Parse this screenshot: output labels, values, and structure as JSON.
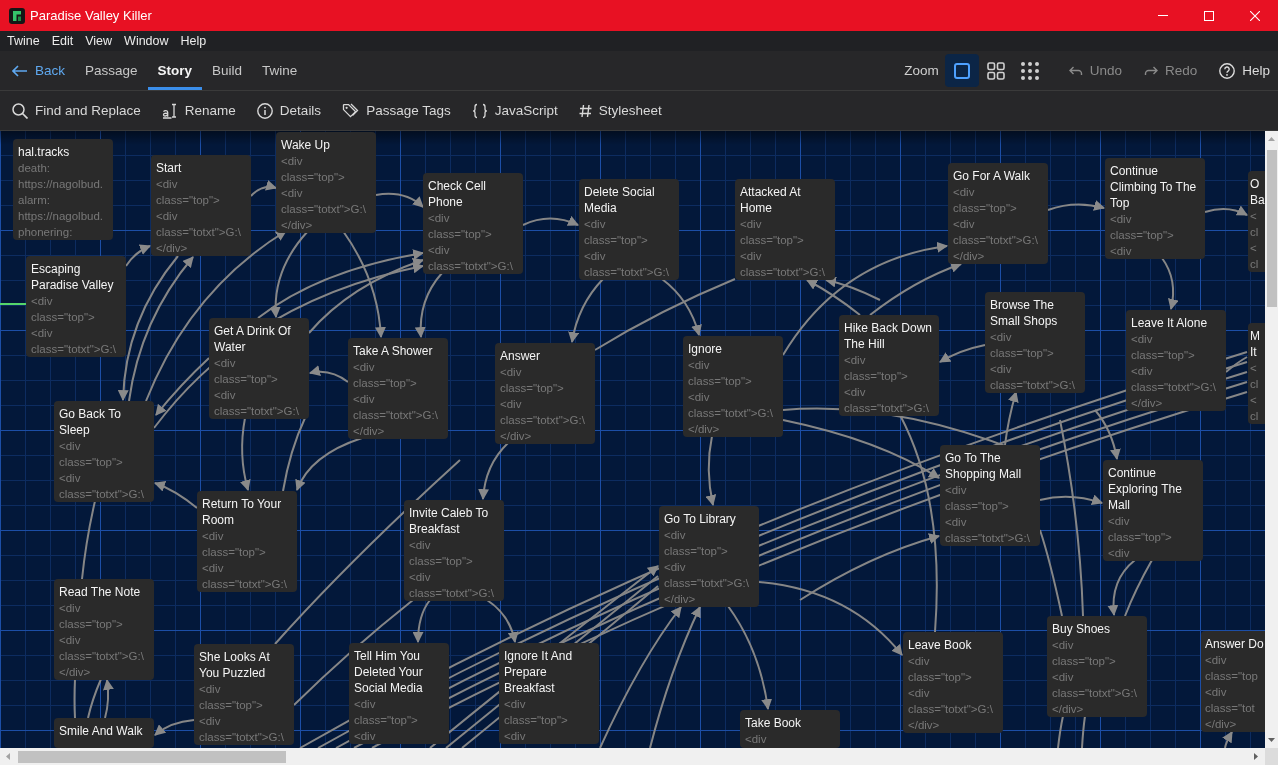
{
  "window": {
    "title": "Paradise Valley Killer"
  },
  "menu_bar": [
    "Twine",
    "Edit",
    "View",
    "Window",
    "Help"
  ],
  "nav": {
    "back": "Back",
    "tabs": [
      {
        "label": "Passage",
        "selected": false
      },
      {
        "label": "Story",
        "selected": true
      },
      {
        "label": "Build",
        "selected": false
      },
      {
        "label": "Twine",
        "selected": false
      }
    ]
  },
  "zoom": {
    "label": "Zoom",
    "levels": [
      {
        "kind": "square",
        "selected": true
      },
      {
        "kind": "grid",
        "selected": false
      },
      {
        "kind": "dots",
        "selected": false
      }
    ]
  },
  "history": [
    {
      "kind": "undo",
      "label": "Undo",
      "disabled": true
    },
    {
      "kind": "redo",
      "label": "Redo",
      "disabled": true
    }
  ],
  "help": {
    "label": "Help"
  },
  "story_tools": [
    {
      "kind": "find",
      "label": "Find and Replace"
    },
    {
      "kind": "rename",
      "label": "Rename"
    },
    {
      "kind": "details",
      "label": "Details"
    },
    {
      "kind": "tags",
      "label": "Passage Tags"
    },
    {
      "kind": "javascript",
      "label": "JavaScript"
    },
    {
      "kind": "stylesheet",
      "label": "Stylesheet"
    }
  ],
  "passages": [
    {
      "title": "hal.tracks",
      "excerpt": [
        "death:",
        "https://nagolbud.",
        "alarm:",
        "https://nagolbud.",
        "phonering:"
      ]
    },
    {
      "title": "Start",
      "excerpt": [
        "<div",
        "class=\"top\">",
        "<div",
        "class=\"totxt\">G:\\",
        "</div>"
      ]
    },
    {
      "title": "Wake Up",
      "excerpt": [
        "<div",
        "class=\"top\">",
        "<div",
        "class=\"totxt\">G:\\",
        "</div>"
      ]
    },
    {
      "title": "Check Cell Phone",
      "excerpt": [
        "<div",
        "class=\"top\">",
        "<div",
        "class=\"totxt\">G:\\"
      ]
    },
    {
      "title": "Delete Social Media",
      "excerpt": [
        "<div",
        "class=\"top\">",
        "<div",
        "class=\"totxt\">G:\\"
      ]
    },
    {
      "title": "Attacked At Home",
      "excerpt": [
        "<div",
        "class=\"top\">",
        "<div",
        "class=\"totxt\">G:\\"
      ]
    },
    {
      "title": "Go For A Walk",
      "excerpt": [
        "<div",
        "class=\"top\">",
        "<div",
        "class=\"totxt\">G:\\",
        "</div>"
      ]
    },
    {
      "title": "Continue Climbing To The Top",
      "excerpt": [
        "<div",
        "class=\"top\">",
        "<div"
      ]
    },
    {
      "title": "O Ba",
      "excerpt": [
        "<",
        "cl",
        "<",
        "cl"
      ]
    },
    {
      "title": "Escaping Paradise Valley",
      "excerpt": [
        "<div",
        "class=\"top\">",
        "<div",
        "class=\"totxt\">G:\\"
      ]
    },
    {
      "title": "Get A Drink Of Water",
      "excerpt": [
        "<div",
        "class=\"top\">",
        "<div",
        "class=\"totxt\">G:\\"
      ]
    },
    {
      "title": "Take A Shower",
      "excerpt": [
        "<div",
        "class=\"top\">",
        "<div",
        "class=\"totxt\">G:\\",
        "</div>"
      ]
    },
    {
      "title": "Answer",
      "excerpt": [
        "<div",
        "class=\"top\">",
        "<div",
        "class=\"totxt\">G:\\",
        "</div>"
      ]
    },
    {
      "title": "Ignore",
      "excerpt": [
        "<div",
        "class=\"top\">",
        "<div",
        "class=\"totxt\">G:\\",
        "</div>"
      ]
    },
    {
      "title": "Hike Back Down The Hill",
      "excerpt": [
        "<div",
        "class=\"top\">",
        "<div",
        "class=\"totxt\">G:\\"
      ]
    },
    {
      "title": "Browse The Small Shops",
      "excerpt": [
        "<div",
        "class=\"top\">",
        "<div",
        "class=\"totxt\">G:\\"
      ]
    },
    {
      "title": "Leave It Alone",
      "excerpt": [
        "<div",
        "class=\"top\">",
        "<div",
        "class=\"totxt\">G:\\",
        "</div>"
      ]
    },
    {
      "title": "M It",
      "excerpt": [
        "<",
        "cl",
        "<",
        "cl"
      ]
    },
    {
      "title": "Go Back To Sleep",
      "excerpt": [
        "<div",
        "class=\"top\">",
        "<div",
        "class=\"totxt\">G:\\"
      ]
    },
    {
      "title": "Return To Your Room",
      "excerpt": [
        "<div",
        "class=\"top\">",
        "<div",
        "class=\"totxt\">G:\\"
      ]
    },
    {
      "title": "Invite Caleb To Breakfast",
      "excerpt": [
        "<div",
        "class=\"top\">",
        "<div",
        "class=\"totxt\">G:\\"
      ]
    },
    {
      "title": "Go To Library",
      "excerpt": [
        "<div",
        "class=\"top\">",
        "<div",
        "class=\"totxt\">G:\\",
        "</div>"
      ]
    },
    {
      "title": "Go To The Shopping Mall",
      "excerpt": [
        "<div",
        "class=\"top\">",
        "<div",
        "class=\"totxt\">G:\\"
      ]
    },
    {
      "title": "Continue Exploring The Mall",
      "excerpt": [
        "<div",
        "class=\"top\">",
        "<div"
      ]
    },
    {
      "title": "Read The Note",
      "excerpt": [
        "<div",
        "class=\"top\">",
        "<div",
        "class=\"totxt\">G:\\",
        "</div>"
      ]
    },
    {
      "title": "She Looks At You Puzzled",
      "excerpt": [
        "<div",
        "class=\"top\">",
        "<div",
        "class=\"totxt\">G:\\"
      ]
    },
    {
      "title": "Tell Him You Deleted Your Social Media",
      "excerpt": [
        "<div",
        "class=\"top\">",
        "<div"
      ]
    },
    {
      "title": "Ignore It And Prepare Breakfast",
      "excerpt": [
        "<div",
        "class=\"top\">",
        "<div"
      ]
    },
    {
      "title": "Leave Book",
      "excerpt": [
        "<div",
        "class=\"top\">",
        "<div",
        "class=\"totxt\">G:\\",
        "</div>"
      ]
    },
    {
      "title": "Buy Shoes",
      "excerpt": [
        "<div",
        "class=\"top\">",
        "<div",
        "class=\"totxt\">G:\\",
        "</div>"
      ]
    },
    {
      "title": "Answer Do",
      "excerpt": [
        "<div",
        "class=\"top",
        "<div",
        "class=\"tot",
        "</div>"
      ]
    },
    {
      "title": "Smile And Walk"
    },
    {
      "title": "Take Book",
      "excerpt": [
        "<div"
      ]
    }
  ]
}
